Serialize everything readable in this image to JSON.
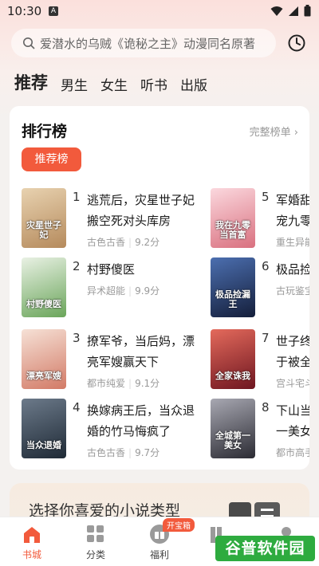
{
  "status_bar": {
    "time": "10:30",
    "notif_letter": "A"
  },
  "search": {
    "placeholder": "爱潜水的乌贼《诡秘之主》动漫同名原著"
  },
  "tabs": [
    {
      "label": "推荐",
      "active": true
    },
    {
      "label": "男生"
    },
    {
      "label": "女生"
    },
    {
      "label": "听书"
    },
    {
      "label": "出版"
    }
  ],
  "ranking": {
    "title": "排行榜",
    "more_label": "完整榜单",
    "pill_label": "推荐榜",
    "books": [
      {
        "rank": "1",
        "title": "逃荒后，灾星世子妃搬空死对头库房",
        "genre": "古色古香",
        "score": "9.2分",
        "cover_text": "灾星世子妃",
        "cover_color": "#c9a37a"
      },
      {
        "rank": "2",
        "title": "村野傻医",
        "genre": "异术超能",
        "score": "9.9分",
        "cover_text": "村野傻医",
        "cover_color": "#7fb56a"
      },
      {
        "rank": "3",
        "title": "撩军爷，当后妈，漂亮军嫂赢天下",
        "genre": "都市纯爱",
        "score": "9.1分",
        "cover_text": "漂亮军嫂",
        "cover_color": "#e2a18d"
      },
      {
        "rank": "4",
        "title": "换嫁病王后，当众退婚的竹马悔疯了",
        "genre": "古色古香",
        "score": "9.7分",
        "cover_text": "当众退婚",
        "cover_color": "#3b4b5e"
      },
      {
        "rank": "5",
        "title": "军婚甜宠九零尘",
        "genre": "重生异能",
        "cover_text": "我在九零当首富",
        "cover_color": "#e89aa7"
      },
      {
        "rank": "6",
        "title": "极品捡漏王",
        "genre": "古玩鉴宝",
        "cover_text": "极品捡漏王",
        "cover_color": "#2a3d66"
      },
      {
        "rank": "7",
        "title": "世子终于被全家诛",
        "genre": "宫斗宅斗",
        "cover_text": "全家诛我",
        "cover_color": "#b5323a"
      },
      {
        "rank": "8",
        "title": "下山当一美女",
        "genre": "都市高手",
        "cover_text": "全城第一美女",
        "cover_color": "#4a4a52"
      }
    ]
  },
  "banner": {
    "text": "选择你喜爱的小说类型"
  },
  "bottom_nav": [
    {
      "label": "书城",
      "icon": "home-icon",
      "active": true
    },
    {
      "label": "分类",
      "icon": "grid-icon"
    },
    {
      "label": "福利",
      "icon": "gift-icon",
      "badge": "开宝箱"
    }
  ],
  "watermark": "谷普软件园",
  "colors": {
    "accent": "#f25a3c"
  }
}
